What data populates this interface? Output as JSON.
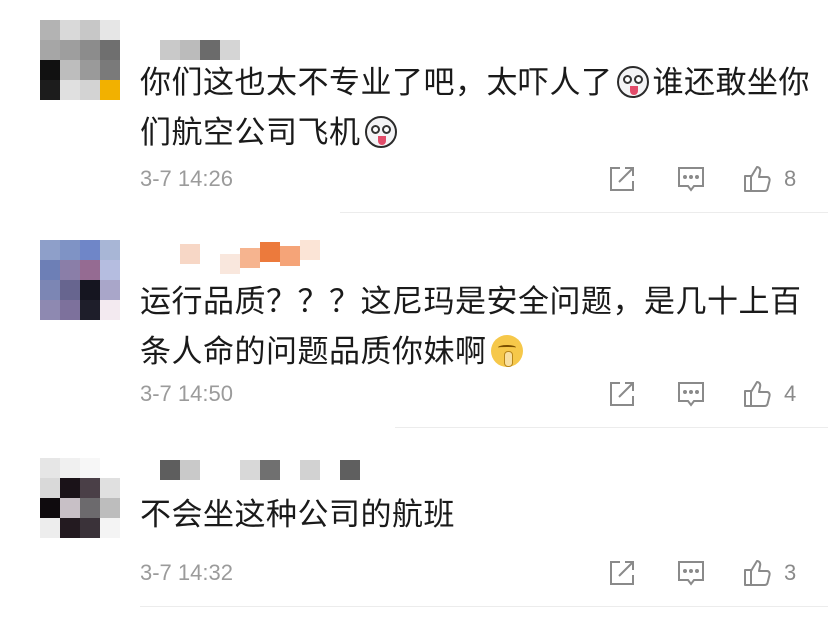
{
  "comments": [
    {
      "text_before": "你们这也太不专业了吧，太吓人了",
      "emoji_1": "dog-emoji",
      "text_after": "谁还敢坐你们航空公司飞机",
      "emoji_2": "dog-emoji",
      "time": "3-7 14:26",
      "likes": "8"
    },
    {
      "text_before": "运行品质？？？这尼玛是安全问题，是几十上百条人命的问题品质你妹啊",
      "emoji_1": "shush-emoji",
      "time": "3-7 14:50",
      "likes": "4"
    },
    {
      "text_before": "不会坐这种公司的航班",
      "time": "3-7 14:32",
      "likes": "3"
    }
  ],
  "icons": {
    "share": "share-icon",
    "reply": "comment-icon",
    "like": "thumbs-up-icon"
  },
  "colors": {
    "text": "#1a1a1a",
    "meta": "#9b9b9b",
    "icon": "#8a8a8a"
  }
}
